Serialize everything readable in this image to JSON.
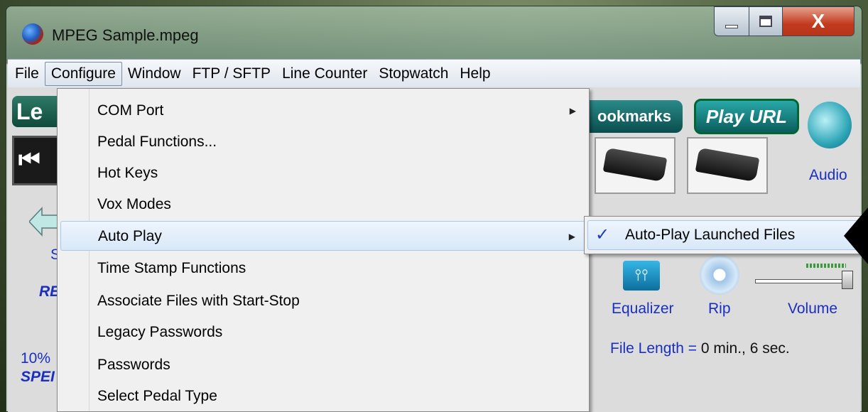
{
  "window": {
    "title": "MPEG Sample.mpeg",
    "close_glyph": "X"
  },
  "menubar": [
    "File",
    "Configure",
    "Window",
    "FTP / SFTP",
    "Line Counter",
    "Stopwatch",
    "Help"
  ],
  "dropdown": [
    {
      "label": "COM Port",
      "submenu": true
    },
    {
      "label": "Pedal Functions...",
      "submenu": false
    },
    {
      "label": "Hot Keys",
      "submenu": false
    },
    {
      "label": "Vox Modes",
      "submenu": false
    },
    {
      "label": "Auto Play",
      "submenu": true
    },
    {
      "label": "Time Stamp Functions",
      "submenu": false
    },
    {
      "label": "Associate Files with Start-Stop",
      "submenu": false
    },
    {
      "label": "Legacy Passwords",
      "submenu": false
    },
    {
      "label": "Passwords",
      "submenu": false
    },
    {
      "label": "Select Pedal Type",
      "submenu": false
    }
  ],
  "submenu": {
    "label": "Auto-Play Launched Files",
    "checked": true,
    "check_glyph": "✓"
  },
  "client": {
    "left_button_partial": "Le",
    "bookmarks": "ookmarks",
    "play_url": "Play URL",
    "audio": "Audio",
    "equalizer": "Equalizer",
    "rip": "Rip",
    "volume": "Volume",
    "file_length_label": "File Length =",
    "file_length_value": "0 min., 6 sec.",
    "partial_s": "S",
    "partial_re": "RE",
    "partial_10": "10%",
    "partial_spe": "SPEI"
  },
  "colors": {
    "accent_blue": "#1a2fbf",
    "button_teal": "#0b5d5d",
    "close_red": "#c33a1e"
  },
  "icons": [
    "app-globe-icon",
    "minimize-icon",
    "maximize-icon",
    "close-icon",
    "rewind-icon",
    "back-arrow-icon",
    "pedal-icon",
    "speaker-icon",
    "equalizer-icon",
    "rip-disc-icon",
    "volume-slider-icon",
    "submenu-arrow-icon",
    "checkmark-icon",
    "pointer-arrow-icon"
  ]
}
